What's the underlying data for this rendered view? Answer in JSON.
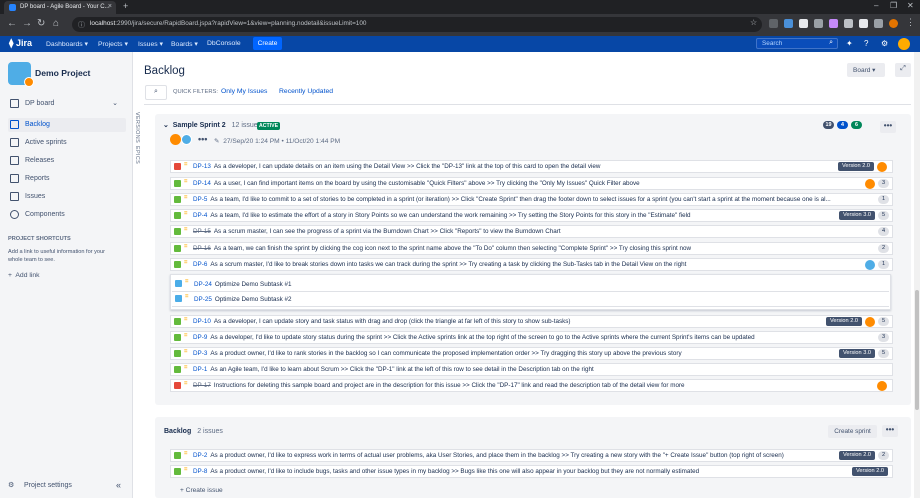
{
  "browser": {
    "tab_title": "DP board - Agile Board - Your C...",
    "url_host": "localhost",
    "url_rest": ":2990/jira/secure/RapidBoard.jspa?rapidView=1&view=planning.nodetail&issueLimit=100"
  },
  "topnav": {
    "logo": "Jira",
    "menus": [
      "Dashboards ▾",
      "Projects ▾",
      "Issues ▾",
      "Boards ▾",
      "DbConsole"
    ],
    "create_label": "Create",
    "search_placeholder": "Search"
  },
  "sidebar": {
    "project_name": "Demo Project",
    "items": [
      {
        "label": "DP board",
        "icon": "board-icon"
      },
      {
        "label": "Backlog",
        "icon": "backlog-icon"
      },
      {
        "label": "Active sprints",
        "icon": "sprint-icon"
      },
      {
        "label": "Releases",
        "icon": "ship-icon"
      },
      {
        "label": "Reports",
        "icon": "chart-icon"
      },
      {
        "label": "Issues",
        "icon": "issues-icon"
      },
      {
        "label": "Components",
        "icon": "puzzle-icon"
      }
    ],
    "shortcuts_header": "PROJECT SHORTCUTS",
    "shortcuts_text": "Add a link to useful information for your whole team to see.",
    "add_link": "Add link",
    "project_settings": "Project settings"
  },
  "vtabs": {
    "versions": "VERSIONS",
    "epics": "EPICS"
  },
  "main": {
    "title": "Backlog",
    "board_button": "Board ▾",
    "quick_filters_label": "QUICK FILTERS:",
    "quick_filters": [
      "Only My Issues",
      "Recently Updated"
    ]
  },
  "sprint": {
    "name": "Sample Sprint 2",
    "count": "12 issues",
    "badge": "ACTIVE",
    "dates": "27/Sep/20 1:24 PM • 11/Oct/20 1:44 PM",
    "pills": [
      {
        "v": "19",
        "color": "#42526e"
      },
      {
        "v": "4",
        "color": "#0052cc"
      },
      {
        "v": "6",
        "color": "#00875a"
      }
    ],
    "issues": [
      {
        "type": "bug",
        "key": "DP-13",
        "done": false,
        "text": "As a developer, I can update details on an item using the Detail View >> Click the \"DP-13\" link at the top of this card to open the detail view",
        "version": "Version 2.0",
        "est": "",
        "avatar": true
      },
      {
        "type": "story",
        "key": "DP-14",
        "done": false,
        "text": "As a user, I can find important items on the board by using the customisable \"Quick Filters\" above >> Try clicking the \"Only My Issues\" Quick Filter above",
        "version": "",
        "est": "3",
        "avatar": true
      },
      {
        "type": "story",
        "key": "DP-5",
        "done": false,
        "text": "As a team, I'd like to commit to a set of stories to be completed in a sprint (or iteration) >> Click \"Create Sprint\" then drag the footer down to select issues for a sprint (you can't start a sprint at the moment because one is al...",
        "version": "",
        "est": "1",
        "avatar": false
      },
      {
        "type": "story",
        "key": "DP-4",
        "done": false,
        "text": "As a team, I'd like to estimate the effort of a story in Story Points so we can understand the work remaining >> Try setting the Story Points for this story in the \"Estimate\" field",
        "version": "Version 3.0",
        "est": "5",
        "avatar": false
      },
      {
        "type": "story",
        "key": "DP-15",
        "done": true,
        "text": "As a scrum master, I can see the progress of a sprint via the Burndown Chart >> Click \"Reports\" to view the Burndown Chart",
        "version": "",
        "est": "4",
        "avatar": false
      },
      {
        "type": "story",
        "key": "DP-16",
        "done": true,
        "text": "As a team, we can finish the sprint by clicking the cog icon next to the sprint name above the \"To Do\" column then selecting \"Complete Sprint\" >> Try closing this sprint now",
        "version": "",
        "est": "2",
        "avatar": false
      },
      {
        "type": "story",
        "key": "DP-6",
        "done": false,
        "text": "As a scrum master, I'd like to break stories down into tasks we can track during the sprint >> Try creating a task by clicking the Sub-Tasks tab in the Detail View on the right",
        "version": "",
        "est": "1",
        "avatar": true
      }
    ],
    "subtasks": [
      {
        "key": "DP-24",
        "text": "Optimize Demo Subtask #1"
      },
      {
        "key": "DP-25",
        "text": "Optimize Demo Subtask #2"
      }
    ],
    "issues2": [
      {
        "type": "story",
        "key": "DP-10",
        "done": false,
        "text": "As a developer, I can update story and task status with drag and drop (click the triangle at far left of this story to show sub-tasks)",
        "version": "Version 2.0",
        "est": "5",
        "avatar": true
      },
      {
        "type": "story",
        "key": "DP-9",
        "done": false,
        "text": "As a developer, I'd like to update story status during the sprint >> Click the Active sprints link at the top right of the screen to go to the Active sprints where the current Sprint's items can be updated",
        "version": "",
        "est": "3",
        "avatar": false
      },
      {
        "type": "story",
        "key": "DP-3",
        "done": false,
        "text": "As a product owner, I'd like to rank stories in the backlog so I can communicate the proposed implementation order >> Try dragging this story up above the previous story",
        "version": "Version 3.0",
        "est": "5",
        "avatar": false
      },
      {
        "type": "story",
        "key": "DP-1",
        "done": false,
        "text": "As an Agile team, I'd like to learn about Scrum >> Click the \"DP-1\" link at the left of this row to see detail in the Description tab on the right",
        "version": "",
        "est": "",
        "avatar": false
      },
      {
        "type": "bug",
        "key": "DP-17",
        "done": true,
        "text": "Instructions for deleting this sample board and project are in the description for this issue >> Click the \"DP-17\" link and read the description tab of the detail view for more",
        "version": "",
        "est": "",
        "avatar": true
      }
    ]
  },
  "backlog": {
    "name": "Backlog",
    "count": "2 issues",
    "create_sprint": "Create sprint",
    "issues": [
      {
        "type": "story",
        "key": "DP-2",
        "done": false,
        "text": "As a product owner, I'd like to express work in terms of actual user problems, aka User Stories, and place them in the backlog >> Try creating a new story with the \"+ Create Issue\" button (top right of screen)",
        "version": "Version 2.0",
        "est": "2",
        "avatar": false
      },
      {
        "type": "story",
        "key": "DP-8",
        "done": false,
        "text": "As a product owner, I'd like to include bugs, tasks and other issue types in my backlog >> Bugs like this one will also appear in your backlog but they are not normally estimated",
        "version": "Version 2.0",
        "est": "",
        "avatar": false
      }
    ],
    "create_issue": "+ Create issue"
  },
  "colors": {
    "bug": "#e5493a",
    "story": "#63ba3c",
    "link": "#0052cc",
    "nav": "#0747a6"
  }
}
